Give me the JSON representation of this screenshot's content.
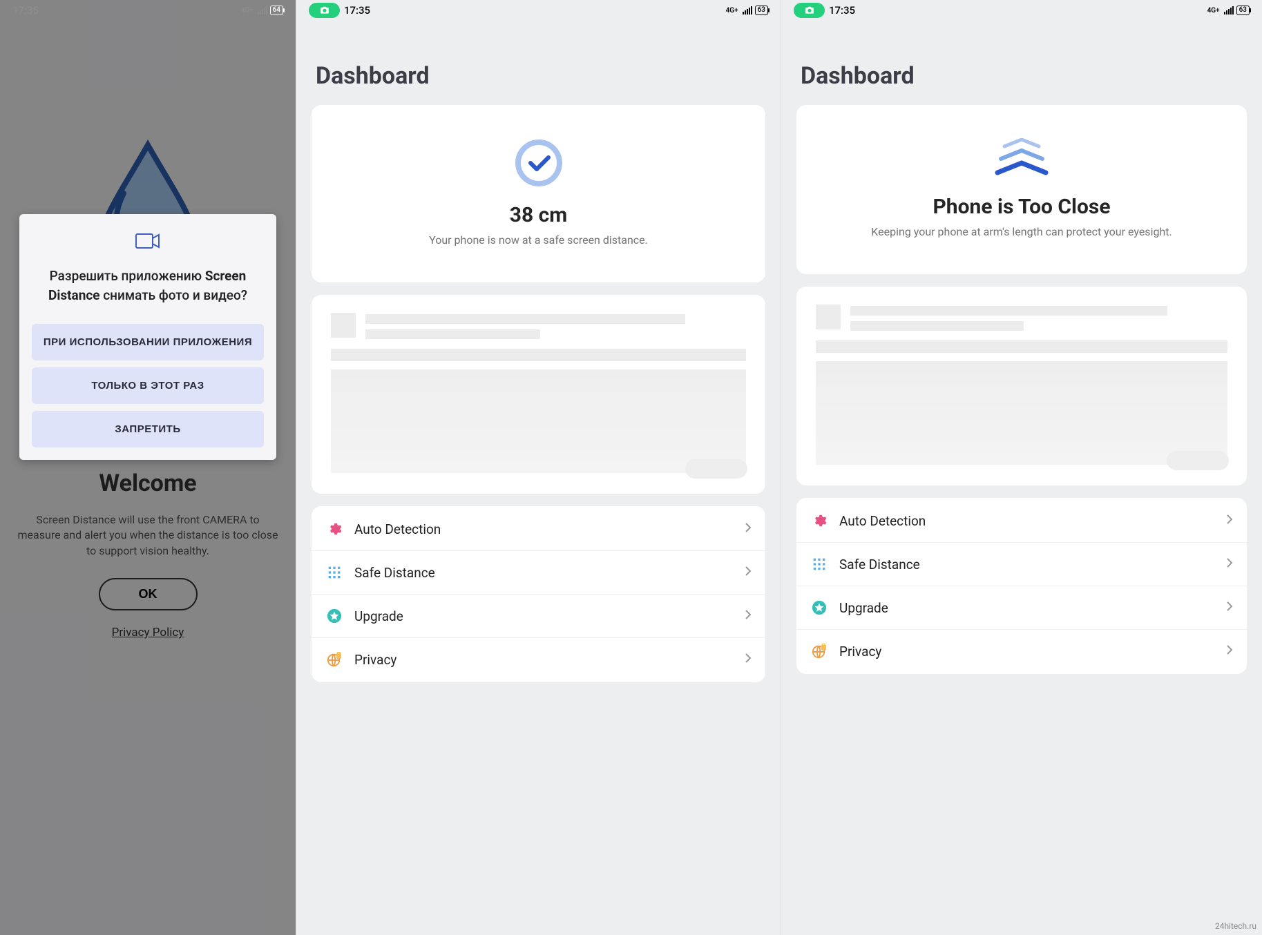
{
  "watermark": "24hitech.ru",
  "screen1": {
    "time": "17:35",
    "net": "4G+",
    "battery": "64",
    "welcome_title": "Welcome",
    "welcome_desc": "Screen Distance will use the front CAMERA to measure and alert you when the distance is too close to support vision healthy.",
    "ok_label": "OK",
    "privacy_label": "Privacy Policy",
    "dialog": {
      "text_pre": "Разрешить приложению ",
      "appname": "Screen Distance",
      "text_post": " снимать фото и видео?",
      "btn_while": "ПРИ ИСПОЛЬЗОВАНИИ ПРИЛОЖЕНИЯ",
      "btn_once": "ТОЛЬКО В ЭТОТ РАЗ",
      "btn_deny": "ЗАПРЕТИТЬ"
    }
  },
  "screen2": {
    "time": "17:35",
    "net": "4G+",
    "battery": "63",
    "title": "Dashboard",
    "status_heading": "38 cm",
    "status_sub": "Your phone is now at a safe screen distance.",
    "settings": [
      {
        "label": "Auto Detection",
        "icon": "gear"
      },
      {
        "label": "Safe Distance",
        "icon": "grid"
      },
      {
        "label": "Upgrade",
        "icon": "star"
      },
      {
        "label": "Privacy",
        "icon": "globe"
      }
    ]
  },
  "screen3": {
    "time": "17:35",
    "net": "4G+",
    "battery": "63",
    "title": "Dashboard",
    "status_heading": "Phone is Too Close",
    "status_sub": "Keeping your phone at arm's length can protect your eyesight.",
    "settings": [
      {
        "label": "Auto Detection",
        "icon": "gear"
      },
      {
        "label": "Safe Distance",
        "icon": "grid"
      },
      {
        "label": "Upgrade",
        "icon": "star"
      },
      {
        "label": "Privacy",
        "icon": "globe"
      }
    ]
  }
}
